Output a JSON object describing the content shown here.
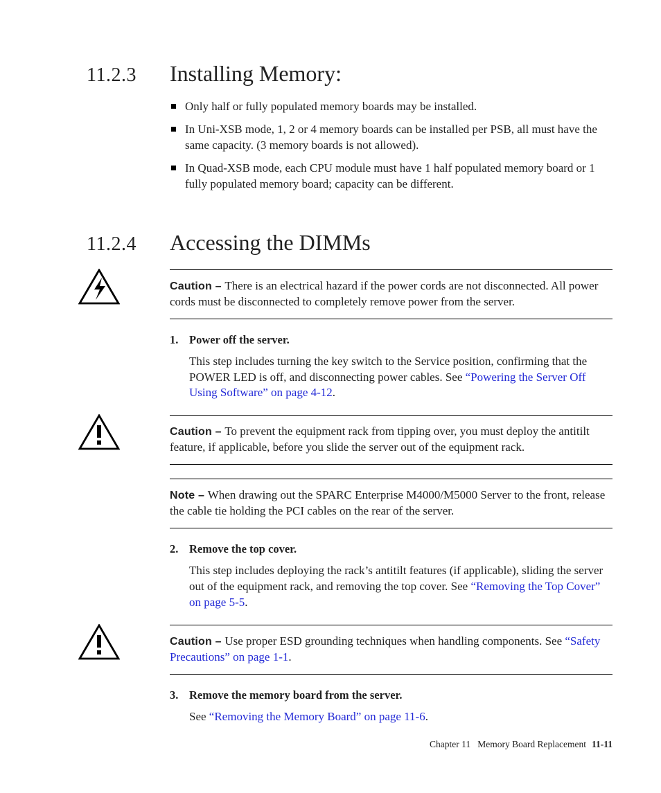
{
  "section1": {
    "number": "11.2.3",
    "title": "Installing Memory:",
    "bullets": [
      "Only half or fully populated memory boards may be installed.",
      "In Uni-XSB mode, 1, 2 or 4 memory boards can be installed per PSB, all must have the same capacity. (3 memory boards is not allowed).",
      "In Quad-XSB mode, each CPU module must have 1 half populated memory board or 1 fully populated memory board; capacity can be different."
    ]
  },
  "section2": {
    "number": "11.2.4",
    "title": "Accessing the DIMMs",
    "callout1": {
      "label": "Caution – ",
      "text": "There is an electrical hazard if the power cords are not disconnected. All power cords must be disconnected to completely remove power from the server."
    },
    "step1": {
      "num": "1.",
      "title": "Power off the server.",
      "body_pre": "This step includes turning the key switch to the Service position, confirming that the POWER LED is off, and disconnecting power cables. See ",
      "link": "“Powering the Server Off Using Software” on page 4-12",
      "body_post": "."
    },
    "callout2": {
      "label": "Caution – ",
      "text": "To prevent the equipment rack from tipping over, you must deploy the antitilt feature, if applicable, before you slide the server out of the equipment rack."
    },
    "note1": {
      "label": "Note – ",
      "text": "When drawing out the SPARC Enterprise M4000/M5000 Server to the front, release the cable tie holding the PCI cables on the rear of the server."
    },
    "step2": {
      "num": "2.",
      "title": "Remove the top cover.",
      "body_pre": "This step includes deploying the rack’s antitilt features (if applicable), sliding the server out of the equipment rack, and removing the top cover. See ",
      "link": "“Removing the Top Cover” on page 5-5",
      "body_post": "."
    },
    "callout3": {
      "label": "Caution – ",
      "text_pre": "Use proper ESD grounding techniques when handling components. See ",
      "link": "“Safety Precautions” on page 1-1",
      "text_post": "."
    },
    "step3": {
      "num": "3.",
      "title": "Remove the memory board from the server.",
      "body_pre": "See ",
      "link": "“Removing the Memory Board” on page 11-6",
      "body_post": "."
    }
  },
  "footer": {
    "chapter": "Chapter 11",
    "title": "Memory Board Replacement",
    "pageno": "11-11"
  }
}
